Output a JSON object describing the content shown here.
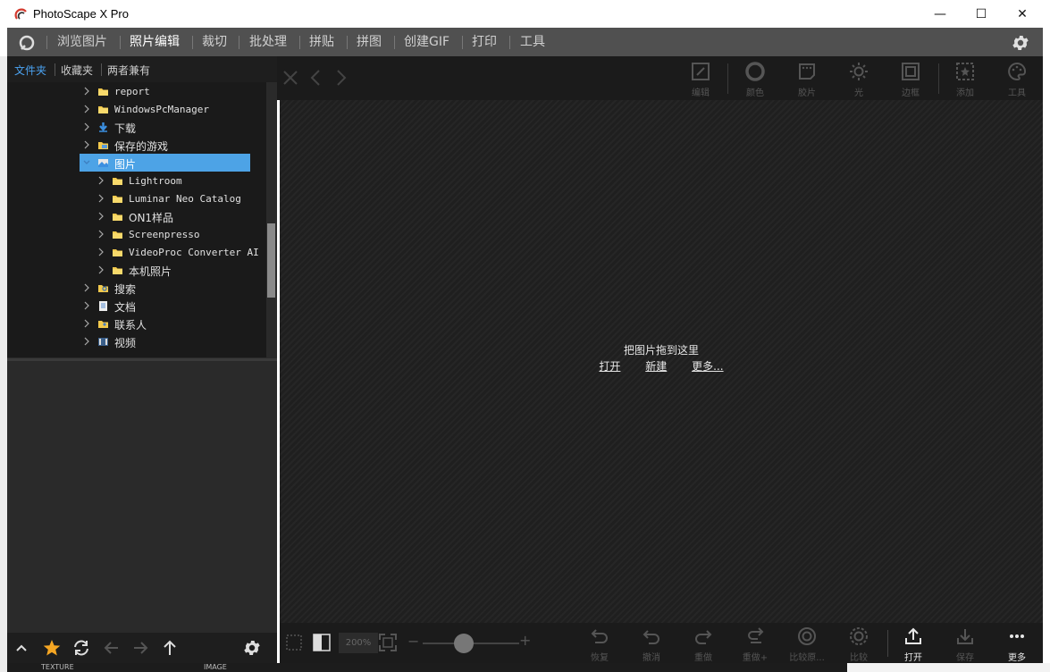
{
  "window": {
    "title": "PhotoScape X Pro",
    "controls": {
      "minimize": "—",
      "maximize": "☐",
      "close": "✕"
    }
  },
  "menu": {
    "tabs": [
      "浏览图片",
      "照片编辑",
      "裁切",
      "批处理",
      "拼贴",
      "拼图",
      "创建GIF",
      "打印",
      "工具"
    ],
    "active_tab": "照片编辑"
  },
  "left_tabs": [
    "文件夹",
    "收藏夹",
    "两者兼有"
  ],
  "tree": [
    {
      "label": "report",
      "level": 1,
      "icon": "folder-icon",
      "mono": true
    },
    {
      "label": "WindowsPcManager",
      "level": 1,
      "icon": "folder-icon",
      "mono": true
    },
    {
      "label": "下载",
      "level": 1,
      "icon": "download-icon"
    },
    {
      "label": "保存的游戏",
      "level": 1,
      "icon": "saved-games-icon"
    },
    {
      "label": "图片",
      "level": 1,
      "icon": "pictures-icon",
      "selected": true
    },
    {
      "label": "Lightroom",
      "level": 2,
      "icon": "folder-icon",
      "mono": true
    },
    {
      "label": "Luminar Neo Catalog",
      "level": 2,
      "icon": "folder-icon",
      "mono": true
    },
    {
      "label": "ON1样品",
      "level": 2,
      "icon": "folder-icon"
    },
    {
      "label": "Screenpresso",
      "level": 2,
      "icon": "folder-icon",
      "mono": true
    },
    {
      "label": "VideoProc Converter AI",
      "level": 2,
      "icon": "folder-icon",
      "mono": true
    },
    {
      "label": "本机照片",
      "level": 2,
      "icon": "folder-icon"
    },
    {
      "label": "搜索",
      "level": 1,
      "icon": "search-folder-icon"
    },
    {
      "label": "文档",
      "level": 1,
      "icon": "documents-icon"
    },
    {
      "label": "联系人",
      "level": 1,
      "icon": "contacts-icon"
    },
    {
      "label": "视频",
      "level": 1,
      "icon": "videos-icon"
    }
  ],
  "editor_tools": [
    "编辑",
    "颜色",
    "胶片",
    "光",
    "边框",
    "添加",
    "工具"
  ],
  "canvas": {
    "message": "把图片拖到这里",
    "links": [
      "打开",
      "新建",
      "更多..."
    ]
  },
  "zoom": "200%",
  "bottom_tools": [
    "恢复",
    "撤消",
    "重做",
    "重做+",
    "比较原...",
    "比较",
    "打开",
    "保存",
    "更多"
  ],
  "bottom_strip": [
    "TEXTURE",
    "IMAGE"
  ],
  "colors": {
    "accent_blue": "#4ba3f2",
    "selection": "#4da3e6",
    "star": "#f5a623"
  }
}
